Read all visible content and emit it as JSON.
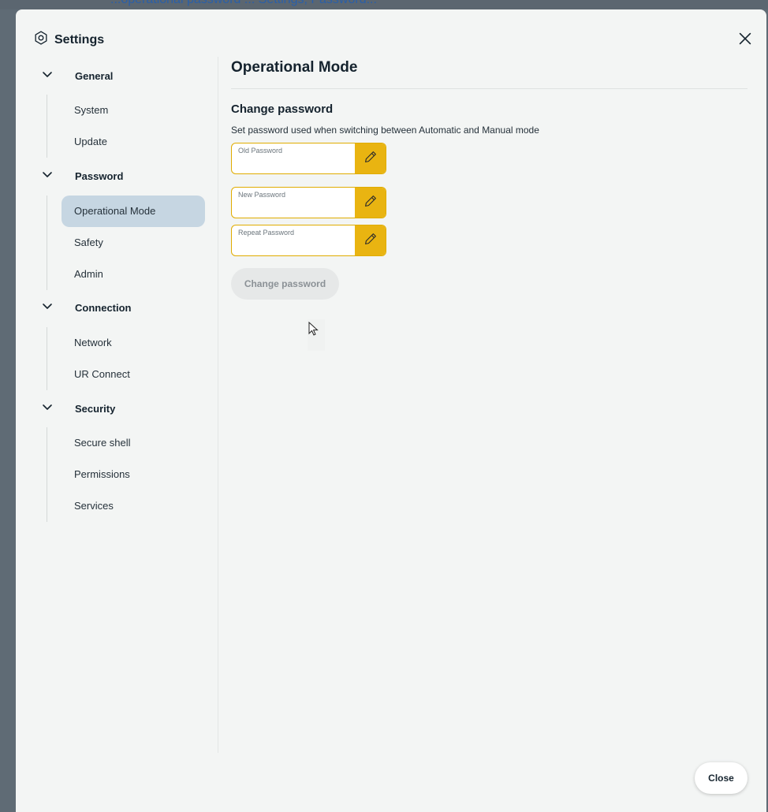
{
  "background": {
    "overlay_text": "...operational password ... Settings, Password..."
  },
  "dialog": {
    "title": "Settings",
    "close_icon": "close-icon",
    "settings_icon": "gear-icon"
  },
  "sidebar": {
    "sections": [
      {
        "label": "General",
        "items": [
          "System",
          "Update"
        ]
      },
      {
        "label": "Password",
        "items": [
          "Operational Mode",
          "Safety",
          "Admin"
        ]
      },
      {
        "label": "Connection",
        "items": [
          "Network",
          "UR Connect"
        ]
      },
      {
        "label": "Security",
        "items": [
          "Secure shell",
          "Permissions",
          "Services"
        ]
      }
    ],
    "active_item": "Operational Mode"
  },
  "main": {
    "page_title": "Operational Mode",
    "section_title": "Change password",
    "description": "Set password used when switching between Automatic and Manual mode",
    "fields": [
      {
        "label": "Old Password",
        "value": ""
      },
      {
        "label": "New Password",
        "value": ""
      },
      {
        "label": "Repeat Password",
        "value": ""
      }
    ],
    "change_button": "Change password"
  },
  "footer": {
    "close_button": "Close"
  },
  "colors": {
    "accent": "#e9b411",
    "active_nav": "#c6d6e2",
    "dialog_bg": "#f3f5f4",
    "backdrop": "#5f6b75"
  }
}
